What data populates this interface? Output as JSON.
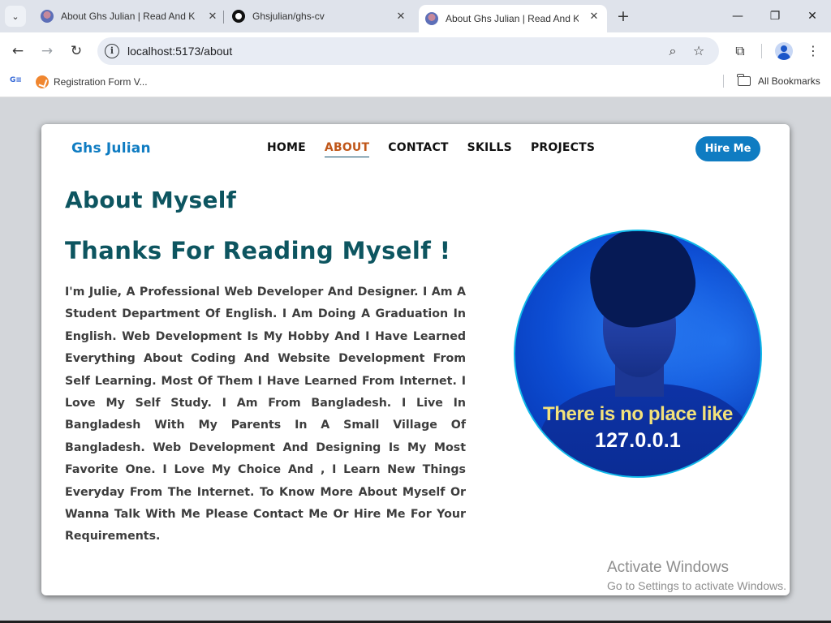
{
  "browser": {
    "tabs": [
      {
        "title": "About Ghs Julian | Read And Kn",
        "favicon": "julian-avatar",
        "active": false
      },
      {
        "title": "Ghsjulian/ghs-cv",
        "favicon": "github-icon",
        "active": false
      },
      {
        "title": "About Ghs Julian | Read And Kn",
        "favicon": "julian-avatar",
        "active": true
      }
    ],
    "tab_search_glyph": "⌄",
    "close_glyph": "✕",
    "new_tab_glyph": "+",
    "window_controls": {
      "minimize": "—",
      "maximize": "❐",
      "close": "✕"
    },
    "nav": {
      "back": "←",
      "forward": "→",
      "reload": "↻"
    },
    "url": "localhost:5173/about",
    "info_glyph": "i",
    "omnibox_icons": {
      "zoom": "⌕",
      "bookmark": "☆"
    },
    "toolbar_icons": {
      "extensions": "⧉",
      "menu": "⋮"
    },
    "bookmarks": {
      "apps_glyph": "G≡",
      "items": [
        {
          "label": "Registration Form V..."
        }
      ],
      "all_bookmarks": "All Bookmarks"
    }
  },
  "site": {
    "brand": "Ghs Julian",
    "nav": [
      {
        "label": "HOME",
        "active": false
      },
      {
        "label": "ABOUT",
        "active": true
      },
      {
        "label": "CONTACT",
        "active": false
      },
      {
        "label": "SKILLS",
        "active": false
      },
      {
        "label": "PROJECTS",
        "active": false
      }
    ],
    "hire_button": "Hire Me",
    "about_title": "About Myself",
    "thanks_title": "Thanks For Reading Myself !",
    "bio": "I'm Julie, A Professional Web Developer And Designer. I Am A Student Department Of English. I Am Doing A Graduation In English. Web Development Is My Hobby And I Have Learned Everything About Coding And Website Development From Self Learning. Most Of Them I Have Learned From Internet. I Love My Self Study. I Am From Bangladesh. I Live In Bangladesh With My Parents In A Small Village Of Bangladesh. Web Development And Designing Is My Most Favorite One. I Love My Choice And , I Learn New Things Everyday From The Internet. To Know More About Myself Or Wanna Talk With Me Please Contact Me Or Hire Me For Your Requirements.",
    "portrait": {
      "caption_line1": "There is no place like",
      "caption_line2": "127.0.0.1"
    }
  },
  "watermark": {
    "line1": "Activate Windows",
    "line2": "Go to Settings to activate Windows."
  },
  "colors": {
    "brand": "#0f7cc2",
    "heading": "#0d5560",
    "nav_active": "#c0571a",
    "caption_yellow": "#f3e27a"
  }
}
